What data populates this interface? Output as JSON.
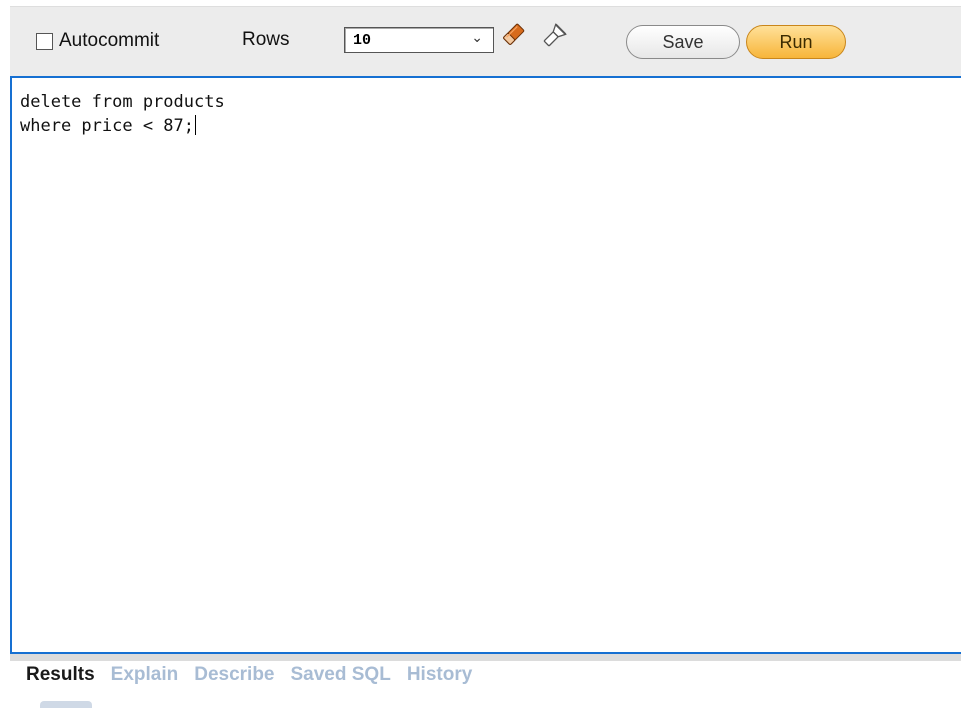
{
  "toolbar": {
    "autocommit_label": "Autocommit",
    "autocommit_checked": false,
    "rows_label": "Rows",
    "rows_value": "10",
    "clear_icon": "eraser-icon",
    "find_icon": "flashlight-icon",
    "save_label": "Save",
    "run_label": "Run"
  },
  "editor": {
    "lines": [
      "delete from products",
      "where price < 87;"
    ]
  },
  "tabs": [
    {
      "label": "Results",
      "active": true
    },
    {
      "label": "Explain",
      "active": false
    },
    {
      "label": "Describe",
      "active": false
    },
    {
      "label": "Saved SQL",
      "active": false
    },
    {
      "label": "History",
      "active": false
    }
  ],
  "colors": {
    "editor_border": "#1670d2",
    "run_button": "#f7b53a",
    "inactive_tab": "#a8bcd4"
  }
}
